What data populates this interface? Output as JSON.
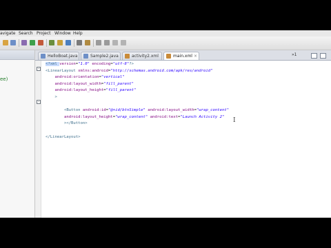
{
  "menu": [
    "avigate",
    "Search",
    "Project",
    "Window",
    "Help"
  ],
  "tabs": [
    {
      "label": "HelloBoat.java",
      "active": false
    },
    {
      "label": "Sample2.java",
      "active": false
    },
    {
      "label": "activity2.xml",
      "active": false
    },
    {
      "label": "main.xml",
      "active": true
    }
  ],
  "tab_overflow": "»1",
  "left_panel": {
    "text": "ee)"
  },
  "editor": {
    "lines": [
      {
        "indent": 0,
        "parts": [
          [
            "tag",
            "<?xml "
          ],
          [
            "attr",
            "version"
          ],
          [
            "plain",
            "="
          ],
          [
            "val",
            "\"1.0\""
          ],
          [
            "plain",
            " "
          ],
          [
            "attr",
            "encoding"
          ],
          [
            "plain",
            "="
          ],
          [
            "val",
            "\"utf-8\""
          ],
          [
            "tag",
            "?>"
          ]
        ]
      },
      {
        "indent": 0,
        "parts": [
          [
            "tag",
            "<LinearLayout "
          ],
          [
            "attr",
            "xmlns:android"
          ],
          [
            "plain",
            "="
          ],
          [
            "val",
            "\"http://schemas.android.com/apk/res/android\""
          ]
        ]
      },
      {
        "indent": 4,
        "parts": [
          [
            "attr",
            "android:orientation"
          ],
          [
            "plain",
            "="
          ],
          [
            "val",
            "\"vertical\""
          ]
        ]
      },
      {
        "indent": 4,
        "parts": [
          [
            "attr",
            "android:layout_width"
          ],
          [
            "plain",
            "="
          ],
          [
            "val",
            "\"fill_parent\""
          ]
        ]
      },
      {
        "indent": 4,
        "parts": [
          [
            "attr",
            "android:layout_height"
          ],
          [
            "plain",
            "="
          ],
          [
            "val",
            "\"fill_parent\""
          ]
        ]
      },
      {
        "indent": 4,
        "parts": [
          [
            "tag",
            ">"
          ]
        ]
      },
      {
        "indent": 0,
        "parts": []
      },
      {
        "indent": 8,
        "parts": [
          [
            "tag",
            "<Button "
          ],
          [
            "attr",
            "android:id"
          ],
          [
            "plain",
            "="
          ],
          [
            "val",
            "\"@+id/btnSimple\""
          ],
          [
            "plain",
            " "
          ],
          [
            "attr",
            "android:layout_width"
          ],
          [
            "plain",
            "="
          ],
          [
            "val",
            "\"wrap_content\""
          ]
        ]
      },
      {
        "indent": 8,
        "parts": [
          [
            "attr",
            "android:layout_height"
          ],
          [
            "plain",
            "="
          ],
          [
            "val",
            "\"wrap_content\""
          ],
          [
            "plain",
            " "
          ],
          [
            "attr",
            "android:text"
          ],
          [
            "plain",
            "="
          ],
          [
            "val",
            "\"Launch Activity 2\""
          ]
        ]
      },
      {
        "indent": 8,
        "parts": [
          [
            "tag",
            "></Button>"
          ]
        ]
      },
      {
        "indent": 0,
        "parts": []
      },
      {
        "indent": 0,
        "parts": [
          [
            "tag",
            "</LinearLayout>"
          ]
        ]
      }
    ]
  },
  "colors": {
    "accent_tab": "#ffffff",
    "tag": "#3f6f8c",
    "attr": "#7f007f",
    "value": "#2a00ff"
  },
  "icons": [
    "new-icon",
    "save-icon",
    "print-icon",
    "debug-icon",
    "run-icon",
    "external-tools-icon",
    "new-java-project-icon",
    "new-package-icon",
    "new-class-icon",
    "open-type-icon",
    "search-icon",
    "next-annotation-icon",
    "previous-annotation-icon",
    "back-icon",
    "forward-icon"
  ]
}
